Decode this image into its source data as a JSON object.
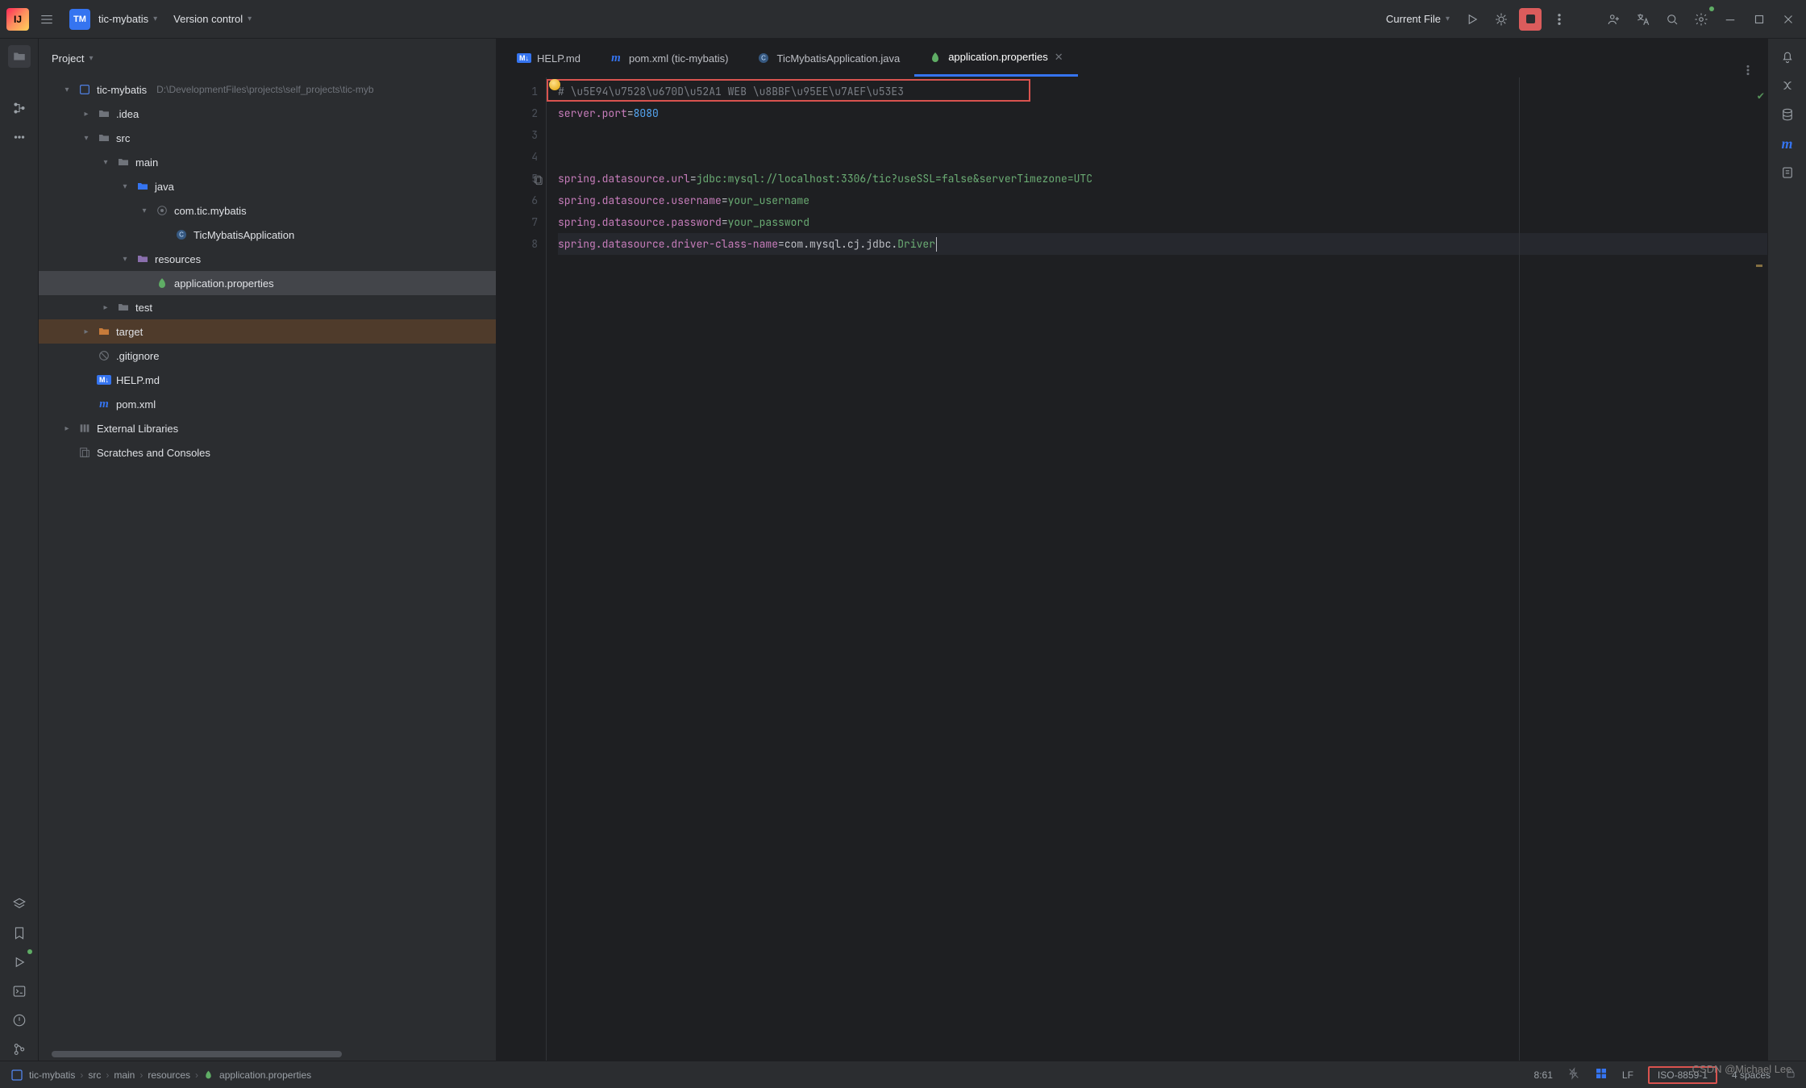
{
  "header": {
    "project_name": "tic-mybatis",
    "project_badge": "TM",
    "version_control": "Version control",
    "run_config": "Current File"
  },
  "project_panel": {
    "title": "Project"
  },
  "tree": [
    {
      "depth": 0,
      "arrow": "down",
      "icon": "module",
      "label": "tic-mybatis",
      "hint": "D:\\DevelopmentFiles\\projects\\self_projects\\tic-myb"
    },
    {
      "depth": 1,
      "arrow": "right",
      "icon": "folder",
      "label": ".idea"
    },
    {
      "depth": 1,
      "arrow": "down",
      "icon": "folder",
      "label": "src"
    },
    {
      "depth": 2,
      "arrow": "down",
      "icon": "folder",
      "label": "main"
    },
    {
      "depth": 3,
      "arrow": "down",
      "icon": "folder-src",
      "label": "java"
    },
    {
      "depth": 4,
      "arrow": "down",
      "icon": "package",
      "label": "com.tic.mybatis"
    },
    {
      "depth": 5,
      "arrow": "",
      "icon": "class",
      "label": "TicMybatisApplication"
    },
    {
      "depth": 3,
      "arrow": "down",
      "icon": "folder-res",
      "label": "resources"
    },
    {
      "depth": 4,
      "arrow": "",
      "icon": "leaf",
      "label": "application.properties",
      "selected": true
    },
    {
      "depth": 2,
      "arrow": "right",
      "icon": "folder",
      "label": "test"
    },
    {
      "depth": 1,
      "arrow": "right",
      "icon": "folder-target",
      "label": "target",
      "highlight": true
    },
    {
      "depth": 1,
      "arrow": "",
      "icon": "gitignore",
      "label": ".gitignore"
    },
    {
      "depth": 1,
      "arrow": "",
      "icon": "md",
      "label": "HELP.md"
    },
    {
      "depth": 1,
      "arrow": "",
      "icon": "maven",
      "label": "pom.xml"
    },
    {
      "depth": 0,
      "arrow": "right",
      "icon": "lib",
      "label": "External Libraries"
    },
    {
      "depth": 0,
      "arrow": "",
      "icon": "scratch",
      "label": "Scratches and Consoles"
    }
  ],
  "tabs": [
    {
      "icon": "md",
      "label": "HELP.md",
      "active": false,
      "close": false
    },
    {
      "icon": "maven",
      "label": "pom.xml (tic-mybatis)",
      "active": false,
      "close": false
    },
    {
      "icon": "class",
      "label": "TicMybatisApplication.java",
      "active": false,
      "close": false
    },
    {
      "icon": "leaf",
      "label": "application.properties",
      "active": true,
      "close": true
    }
  ],
  "editor": {
    "lines": [
      {
        "n": 1,
        "tokens": [
          {
            "c": "tok-comment",
            "t": "# \\u5E94\\u7528\\u670D\\u52A1 WEB \\u8BBF\\u95EE\\u7AEF\\u53E3"
          }
        ]
      },
      {
        "n": 2,
        "tokens": [
          {
            "c": "tok-key",
            "t": "server.port"
          },
          {
            "c": "tok-eq",
            "t": "="
          },
          {
            "c": "tok-num",
            "t": "8080"
          }
        ]
      },
      {
        "n": 3,
        "tokens": []
      },
      {
        "n": 4,
        "tokens": []
      },
      {
        "n": 5,
        "tokens": [
          {
            "c": "tok-key",
            "t": "spring.datasource.url"
          },
          {
            "c": "tok-eq",
            "t": "="
          },
          {
            "c": "tok-val",
            "t": "jdbc:mysql://localhost:3306/tic?useSSL=false&serverTimezone=UTC"
          }
        ],
        "gutter": "copy"
      },
      {
        "n": 6,
        "tokens": [
          {
            "c": "tok-key",
            "t": "spring.datasource.username"
          },
          {
            "c": "tok-eq",
            "t": "="
          },
          {
            "c": "tok-val",
            "t": "your_username"
          }
        ]
      },
      {
        "n": 7,
        "tokens": [
          {
            "c": "tok-key",
            "t": "spring.datasource.password"
          },
          {
            "c": "tok-eq",
            "t": "="
          },
          {
            "c": "tok-val",
            "t": "your_password"
          }
        ],
        "bulb": true
      },
      {
        "n": 8,
        "tokens": [
          {
            "c": "tok-key",
            "t": "spring.datasource.driver-class-name"
          },
          {
            "c": "tok-eq",
            "t": "="
          },
          {
            "c": "tok-q",
            "t": "com.mysql.cj.jdbc."
          },
          {
            "c": "tok-val",
            "t": "Driver"
          }
        ],
        "current": true,
        "caret": true
      }
    ]
  },
  "breadcrumbs": [
    "tic-mybatis",
    "src",
    "main",
    "resources",
    "application.properties"
  ],
  "status": {
    "pos": "8:61",
    "line_sep": "LF",
    "encoding": "ISO-8859-1",
    "indent": "4 spaces"
  },
  "watermark": "CSDN @Michael Lee."
}
